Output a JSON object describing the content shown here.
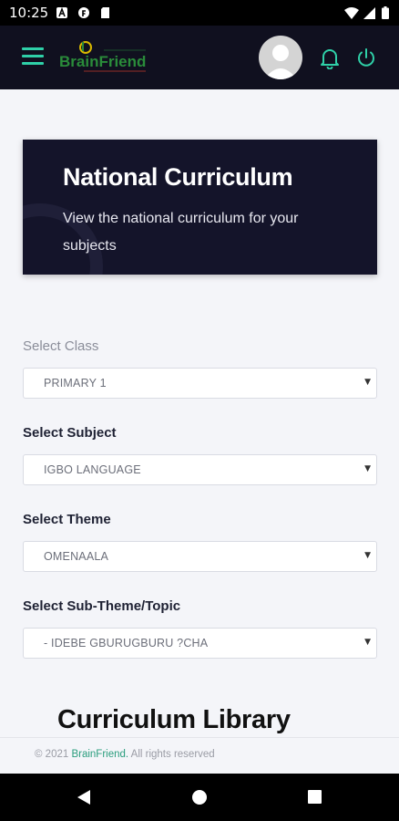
{
  "status_bar": {
    "time": "10:25"
  },
  "app_bar": {
    "logo_text": "BrainFriend",
    "menu_icon": "hamburger-icon",
    "bell_icon": "bell-icon",
    "power_icon": "power-icon",
    "avatar_icon": "avatar"
  },
  "hero": {
    "title": "National Curriculum",
    "subtitle": "View the national curriculum for your subjects"
  },
  "form": {
    "class_label": "Select Class",
    "class_value": "PRIMARY 1",
    "subject_label": "Select Subject",
    "subject_value": "IGBO LANGUAGE",
    "theme_label": "Select Theme",
    "theme_value": "OMENAALA",
    "topic_label": "Select Sub-Theme/Topic",
    "topic_value": "- IDEBE GBURUGBURU ?CHA",
    "caret": "▼"
  },
  "library": {
    "title": "Curriculum Library"
  },
  "footer": {
    "prefix": "© 2021 ",
    "brand": "BrainFriend.",
    "suffix": " All rights reserved"
  },
  "colors": {
    "accent": "#2fd0a8",
    "appbar": "#10101f",
    "hero": "#14142a"
  }
}
